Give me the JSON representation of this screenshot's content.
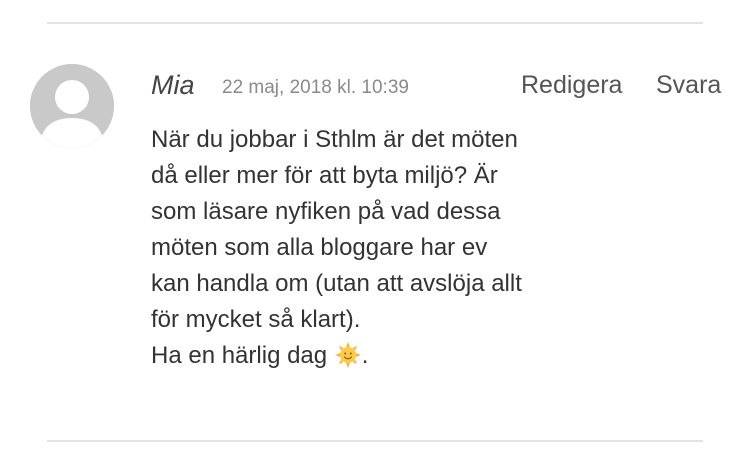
{
  "comment": {
    "author": "Mia",
    "date": "22 maj, 2018 kl. 10:39",
    "actions": {
      "edit": "Redigera",
      "reply": "Svara"
    },
    "body": "När du jobbar i Sthlm är det möten då eller mer för att byta miljö? Är som läsare nyfiken på vad dessa möten som alla bloggare har ev kan handla om (utan att avslöja allt för mycket så klart).",
    "closing_text": "Ha en härlig dag",
    "closing_emoji_icon": "sun-emoji-icon",
    "closing_punctuation": "."
  },
  "colors": {
    "avatar_bg": "#c9c9c9",
    "divider": "#e3e3e3",
    "date_text": "#8a8a8a"
  }
}
